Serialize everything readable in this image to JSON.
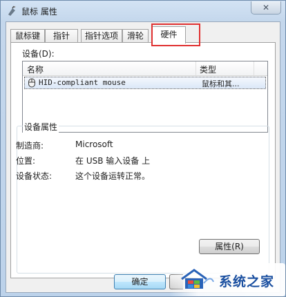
{
  "window": {
    "title": "鼠标 属性",
    "close_label": "✕"
  },
  "tabs": [
    {
      "label": "鼠标键"
    },
    {
      "label": "指针"
    },
    {
      "label": "指针选项"
    },
    {
      "label": "滑轮"
    },
    {
      "label": "硬件",
      "active": true
    }
  ],
  "devices": {
    "label": "设备(D):",
    "columns": [
      "名称",
      "类型"
    ],
    "rows": [
      {
        "name": "HID-compliant mouse",
        "type": "鼠标和其..."
      }
    ]
  },
  "properties": {
    "group_title": "设备属性",
    "manufacturer_label": "制造商:",
    "manufacturer_value": "Microsoft",
    "location_label": "位置:",
    "location_value": "在 USB 输入设备 上",
    "status_label": "设备状态:",
    "status_value": "这个设备运转正常。",
    "button_label": "属性(R)"
  },
  "footer": {
    "ok_label": "确定"
  },
  "watermark": {
    "text": "系统之家"
  },
  "colors": {
    "highlight": "#e03030",
    "watermark_text": "#1a4fa0"
  }
}
